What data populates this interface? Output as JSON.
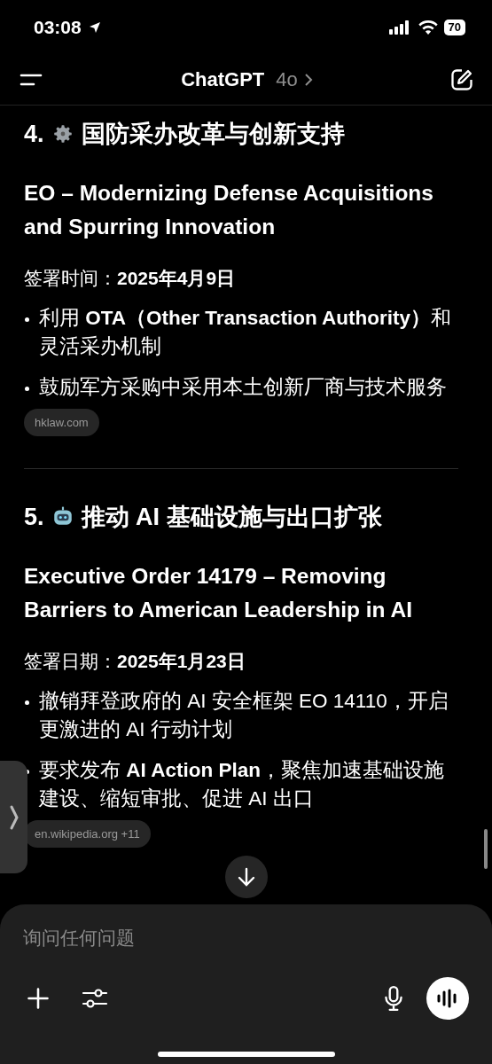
{
  "status_bar": {
    "time": "03:08",
    "battery": "70"
  },
  "header": {
    "title": "ChatGPT",
    "model": "4o"
  },
  "sections": [
    {
      "number": "4.",
      "title": "国防采办改革与创新支持",
      "order_title": "EO – Modernizing Defense Acquisitions and Spurring Innovation",
      "date": "签署时间：**2025年4月9日**",
      "bullets": [
        "利用 **OTA（Other Transaction Authority）**和灵活采办机制",
        "鼓励军方采购中采用本土创新厂商与技术服务"
      ],
      "source": "hklaw.com"
    },
    {
      "number": "5.",
      "title": "推动 AI 基础设施与出口扩张",
      "order_title": "Executive Order 14179 – Removing Barriers to American Leadership in AI",
      "date": "签署日期：**2025年1月23日**",
      "bullets": [
        "撤销拜登政府的 AI 安全框架 EO 14110，开启更激进的 AI 行动计划",
        "要求发布 **AI Action Plan**，聚焦加速基础设施建设、缩短审批、促进 AI 出口"
      ],
      "source": "en.wikipedia.org +11"
    }
  ],
  "composer": {
    "placeholder": "询问任何问题"
  }
}
